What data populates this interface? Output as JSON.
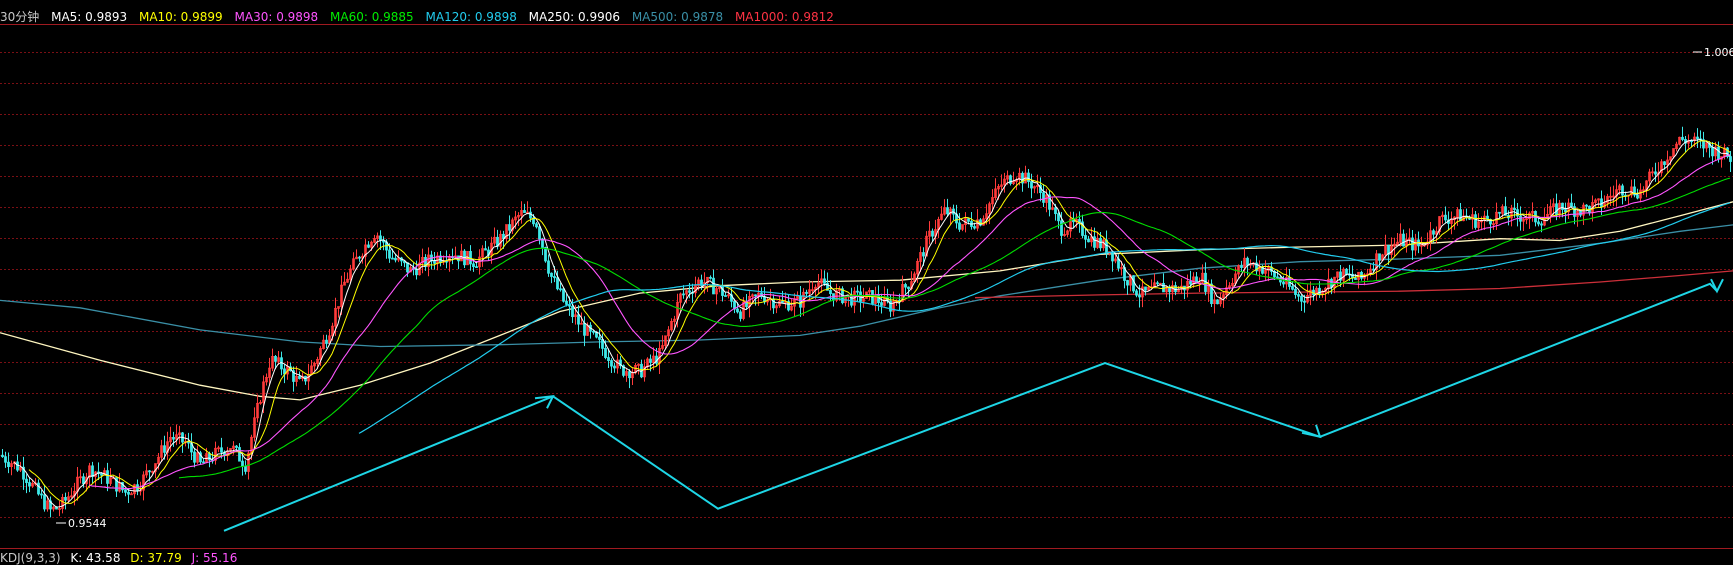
{
  "header": {
    "period": "30分钟",
    "items": [
      {
        "label": "MA5: 0.9893",
        "color": "#ffffff"
      },
      {
        "label": "MA10: 0.9899",
        "color": "#ffff00"
      },
      {
        "label": "MA30: 0.9898",
        "color": "#ff55ff"
      },
      {
        "label": "MA60: 0.9885",
        "color": "#00ee00"
      },
      {
        "label": "MA120: 0.9898",
        "color": "#22ccee"
      },
      {
        "label": "MA250: 0.9906",
        "color": "#ffffff"
      },
      {
        "label": "MA500: 0.9878",
        "color": "#3a8fa6"
      },
      {
        "label": "MA1000: 0.9812",
        "color": "#ff3344"
      }
    ]
  },
  "footer": {
    "items": [
      {
        "label": "KDJ(9,3,3)",
        "color": "#c8c8c8"
      },
      {
        "label": "K: 43.58",
        "color": "#ffffff"
      },
      {
        "label": "D: 37.79",
        "color": "#ffff00"
      },
      {
        "label": "J: 55.16",
        "color": "#ff55ff"
      }
    ]
  },
  "chart_data": {
    "type": "line",
    "title": "",
    "ylim": [
      0.952,
      1.008
    ],
    "grid": true,
    "annotations": {
      "high_label": "1.006",
      "low_label": "0.9544"
    },
    "price_anchors": [
      [
        0,
        0.9612
      ],
      [
        20,
        0.9598
      ],
      [
        40,
        0.9566
      ],
      [
        50,
        0.9552
      ],
      [
        60,
        0.9556
      ],
      [
        75,
        0.9578
      ],
      [
        90,
        0.9598
      ],
      [
        110,
        0.9585
      ],
      [
        125,
        0.9572
      ],
      [
        140,
        0.9582
      ],
      [
        160,
        0.9614
      ],
      [
        170,
        0.9632
      ],
      [
        185,
        0.9626
      ],
      [
        200,
        0.9602
      ],
      [
        215,
        0.9613
      ],
      [
        230,
        0.9622
      ],
      [
        245,
        0.9602
      ],
      [
        260,
        0.9676
      ],
      [
        270,
        0.9716
      ],
      [
        290,
        0.9702
      ],
      [
        300,
        0.9688
      ],
      [
        315,
        0.9714
      ],
      [
        330,
        0.9752
      ],
      [
        345,
        0.9802
      ],
      [
        360,
        0.9832
      ],
      [
        375,
        0.9855
      ],
      [
        390,
        0.9828
      ],
      [
        410,
        0.9812
      ],
      [
        430,
        0.9824
      ],
      [
        450,
        0.9832
      ],
      [
        475,
        0.9822
      ],
      [
        500,
        0.9847
      ],
      [
        520,
        0.9874
      ],
      [
        535,
        0.9868
      ],
      [
        550,
        0.9808
      ],
      [
        565,
        0.9775
      ],
      [
        580,
        0.9753
      ],
      [
        600,
        0.9731
      ],
      [
        620,
        0.9705
      ],
      [
        640,
        0.9703
      ],
      [
        660,
        0.9722
      ],
      [
        680,
        0.9784
      ],
      [
        700,
        0.9802
      ],
      [
        720,
        0.9791
      ],
      [
        740,
        0.9768
      ],
      [
        760,
        0.9787
      ],
      [
        780,
        0.9776
      ],
      [
        800,
        0.9779
      ],
      [
        815,
        0.9802
      ],
      [
        830,
        0.9788
      ],
      [
        850,
        0.9782
      ],
      [
        870,
        0.9784
      ],
      [
        890,
        0.9774
      ],
      [
        910,
        0.9802
      ],
      [
        930,
        0.9852
      ],
      [
        945,
        0.9878
      ],
      [
        960,
        0.9862
      ],
      [
        980,
        0.9868
      ],
      [
        1000,
        0.9905
      ],
      [
        1015,
        0.9918
      ],
      [
        1030,
        0.9908
      ],
      [
        1045,
        0.9892
      ],
      [
        1060,
        0.9858
      ],
      [
        1075,
        0.9862
      ],
      [
        1090,
        0.9848
      ],
      [
        1110,
        0.9834
      ],
      [
        1125,
        0.9806
      ],
      [
        1140,
        0.9786
      ],
      [
        1160,
        0.9794
      ],
      [
        1180,
        0.9792
      ],
      [
        1200,
        0.9808
      ],
      [
        1215,
        0.9776
      ],
      [
        1230,
        0.9802
      ],
      [
        1245,
        0.9822
      ],
      [
        1265,
        0.9814
      ],
      [
        1285,
        0.9798
      ],
      [
        1300,
        0.9782
      ],
      [
        1320,
        0.9794
      ],
      [
        1340,
        0.9808
      ],
      [
        1360,
        0.9802
      ],
      [
        1380,
        0.9832
      ],
      [
        1400,
        0.9845
      ],
      [
        1420,
        0.9838
      ],
      [
        1440,
        0.9868
      ],
      [
        1460,
        0.9872
      ],
      [
        1480,
        0.9865
      ],
      [
        1500,
        0.9874
      ],
      [
        1520,
        0.9872
      ],
      [
        1540,
        0.9868
      ],
      [
        1560,
        0.9882
      ],
      [
        1580,
        0.9878
      ],
      [
        1600,
        0.9884
      ],
      [
        1620,
        0.9902
      ],
      [
        1640,
        0.9898
      ],
      [
        1660,
        0.9928
      ],
      [
        1680,
        0.9955
      ],
      [
        1695,
        0.9952
      ],
      [
        1710,
        0.9945
      ],
      [
        1733,
        0.9934
      ]
    ],
    "ma_series": [
      {
        "name": "MA250",
        "color": "#fff6c0",
        "points": [
          [
            0,
            0.9745
          ],
          [
            100,
            0.9715
          ],
          [
            200,
            0.9688
          ],
          [
            260,
            0.9676
          ],
          [
            300,
            0.9672
          ],
          [
            360,
            0.9688
          ],
          [
            430,
            0.9712
          ],
          [
            500,
            0.9742
          ],
          [
            560,
            0.9768
          ],
          [
            640,
            0.9788
          ],
          [
            720,
            0.9796
          ],
          [
            800,
            0.98
          ],
          [
            900,
            0.9802
          ],
          [
            1000,
            0.9812
          ],
          [
            1100,
            0.983
          ],
          [
            1200,
            0.9835
          ],
          [
            1300,
            0.9838
          ],
          [
            1400,
            0.984
          ],
          [
            1500,
            0.9847
          ],
          [
            1560,
            0.9845
          ],
          [
            1620,
            0.9855
          ],
          [
            1680,
            0.9872
          ],
          [
            1733,
            0.9887
          ]
        ]
      },
      {
        "name": "MA500",
        "color": "#3a8fa6",
        "points": [
          [
            0,
            0.978
          ],
          [
            80,
            0.9772
          ],
          [
            200,
            0.9748
          ],
          [
            300,
            0.9735
          ],
          [
            380,
            0.973
          ],
          [
            500,
            0.9732
          ],
          [
            600,
            0.9735
          ],
          [
            700,
            0.9737
          ],
          [
            800,
            0.9742
          ],
          [
            860,
            0.9752
          ],
          [
            940,
            0.9772
          ],
          [
            1000,
            0.9785
          ],
          [
            1100,
            0.9802
          ],
          [
            1200,
            0.9815
          ],
          [
            1300,
            0.9822
          ],
          [
            1400,
            0.9825
          ],
          [
            1500,
            0.9829
          ],
          [
            1600,
            0.9842
          ],
          [
            1680,
            0.9855
          ],
          [
            1733,
            0.9862
          ]
        ]
      },
      {
        "name": "MA1000",
        "color": "#cc2f39",
        "points": [
          [
            975,
            0.9783
          ],
          [
            1100,
            0.9786
          ],
          [
            1200,
            0.9788
          ],
          [
            1300,
            0.9789
          ],
          [
            1400,
            0.979
          ],
          [
            1500,
            0.9793
          ],
          [
            1600,
            0.98
          ],
          [
            1680,
            0.9807
          ],
          [
            1733,
            0.9812
          ]
        ]
      }
    ],
    "trend_arrows": [
      {
        "color": "#1ed6e6",
        "points": [
          [
            224,
            0.953
          ],
          [
            553,
            0.9676
          ]
        ]
      },
      {
        "color": "#1ed6e6",
        "points": [
          [
            553,
            0.9676
          ],
          [
            718,
            0.9554
          ],
          [
            1105,
            0.9712
          ],
          [
            1320,
            0.9632
          ],
          [
            1710,
            0.9798
          ],
          [
            1717,
            0.979
          ]
        ]
      }
    ]
  }
}
